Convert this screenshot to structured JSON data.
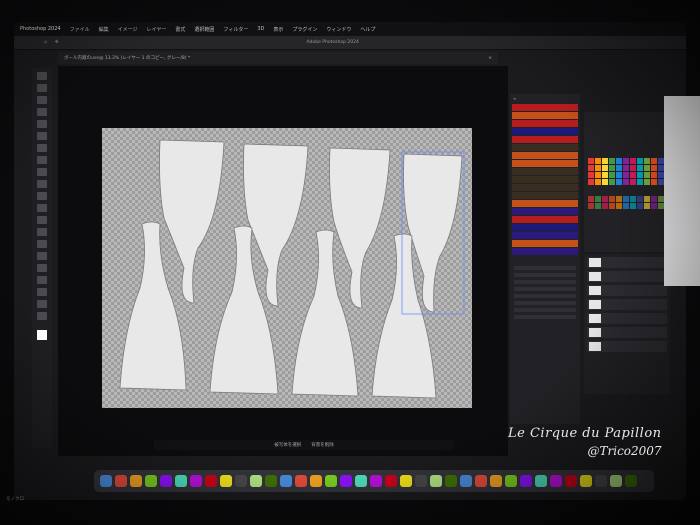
{
  "menubar": {
    "app_name": "Photoshop 2024",
    "items": [
      "ファイル",
      "編集",
      "イメージ",
      "レイヤー",
      "書式",
      "選択範囲",
      "フィルター",
      "3D",
      "表示",
      "プラグイン",
      "ウィンドウ",
      "ヘルプ"
    ]
  },
  "document": {
    "tab_title": "ボール内蔵のuse@ 13.3% (レイヤー 1 のコピー, グレー/8) *",
    "window_title": "Adobe Photoshop 2024"
  },
  "taskbar": {
    "left_label": "被写体を選択",
    "right_label": "背景を削除"
  },
  "watermark": {
    "title": "Le Cirque du Papillon",
    "handle": "@Trico2007"
  },
  "bottom_left": {
    "label": "モノクロ"
  },
  "colors": {
    "canvas_bg": "#b9b9b9",
    "pattern_fill": "#e8e8e8",
    "selection": "#6a8cff",
    "layer_orange": "#c4501a",
    "layer_red": "#b81d1d",
    "layer_purple": "#2c1a7a",
    "layer_dark": "#3a2e20"
  },
  "layer_colors": [
    "#b81d1d",
    "#c4501a",
    "#b81d1d",
    "#1a1a7a",
    "#b81d1d",
    "#3a2e20",
    "#c4501a",
    "#c4501a",
    "#3a2e20",
    "#3a2e20",
    "#3a2e20",
    "#3a2e20",
    "#c4501a",
    "#2c1a7a",
    "#b81d1d",
    "#1a1a7a",
    "#2c1a7a",
    "#c4501a",
    "#2c1a7a"
  ]
}
